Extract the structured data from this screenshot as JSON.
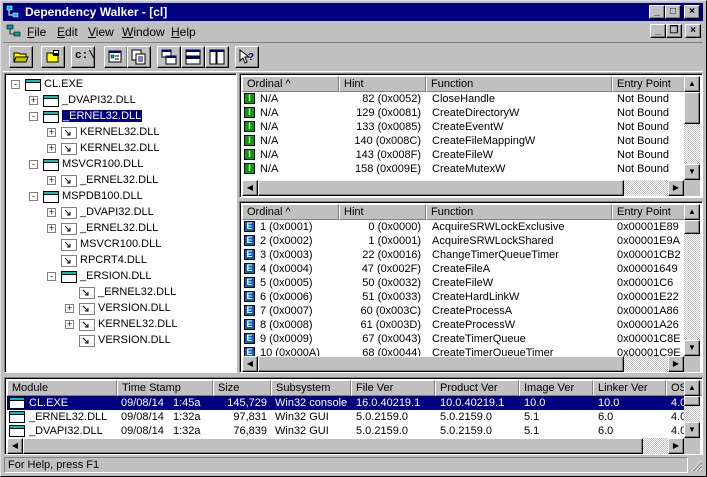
{
  "window": {
    "title": "Dependency Walker - [cl]",
    "caption_buttons": {
      "minimize": "_",
      "maximize": "□",
      "close": "×"
    },
    "mdi_buttons": {
      "minimize": "_",
      "restore": "❐",
      "close": "×"
    }
  },
  "menu": [
    {
      "label": "File",
      "key": "F",
      "rest": "ile"
    },
    {
      "label": "Edit",
      "key": "E",
      "rest": "dit"
    },
    {
      "label": "View",
      "key": "V",
      "rest": "iew"
    },
    {
      "label": "Window",
      "key": "W",
      "rest": "indow"
    },
    {
      "label": "Help",
      "key": "H",
      "rest": "elp"
    }
  ],
  "toolbar": {
    "buttons": [
      {
        "icon": "open-folder-icon"
      },
      {
        "icon": "save-icon"
      },
      {
        "icon": "cpath-icon",
        "text": "c:\\"
      },
      {
        "icon": "properties-icon"
      },
      {
        "icon": "copy-icon"
      },
      {
        "icon": "cascade-icon"
      },
      {
        "icon": "tile-horizontal-icon"
      },
      {
        "icon": "tile-vertical-icon"
      },
      {
        "icon": "help-context-icon"
      }
    ]
  },
  "tree": {
    "nodes": [
      {
        "label": "CL.EXE",
        "level": 0,
        "expander": "-",
        "icon": "exe"
      },
      {
        "label": "_DVAPI32.DLL",
        "level": 1,
        "expander": "+",
        "icon": "dll"
      },
      {
        "label": "_ERNEL32.DLL",
        "level": 1,
        "expander": "-",
        "icon": "dll",
        "selected": true
      },
      {
        "label": "KERNEL32.DLL",
        "level": 2,
        "expander": "+",
        "icon": "fwd"
      },
      {
        "label": "KERNEL32.DLL",
        "level": 2,
        "expander": "+",
        "icon": "fwd-link"
      },
      {
        "label": "MSVCR100.DLL",
        "level": 1,
        "expander": "-",
        "icon": "dll"
      },
      {
        "label": "_ERNEL32.DLL",
        "level": 2,
        "expander": "+",
        "icon": "fwd"
      },
      {
        "label": "MSPDB100.DLL",
        "level": 1,
        "expander": "-",
        "icon": "dll"
      },
      {
        "label": "_DVAPI32.DLL",
        "level": 2,
        "expander": "+",
        "icon": "fwd"
      },
      {
        "label": "_ERNEL32.DLL",
        "level": 2,
        "expander": "+",
        "icon": "fwd"
      },
      {
        "label": "MSVCR100.DLL",
        "level": 2,
        "expander": "",
        "icon": "fwd"
      },
      {
        "label": "RPCRT4.DLL",
        "level": 2,
        "expander": "",
        "icon": "fwd"
      },
      {
        "label": "_ERSION.DLL",
        "level": 2,
        "expander": "-",
        "icon": "dll"
      },
      {
        "label": "_ERNEL32.DLL",
        "level": 3,
        "expander": "",
        "icon": "fwd"
      },
      {
        "label": "VERSION.DLL",
        "level": 3,
        "expander": "+",
        "icon": "fwd"
      },
      {
        "label": "KERNEL32.DLL",
        "level": 3,
        "expander": "+",
        "icon": "fwd"
      },
      {
        "label": "VERSION.DLL",
        "level": 3,
        "expander": "",
        "icon": "fwd-link"
      }
    ]
  },
  "imports": {
    "headers": [
      "Ordinal ^",
      "Hint",
      "Function",
      "Entry Point"
    ],
    "rows": [
      {
        "type": "I",
        "ordinal": "N/A",
        "hint": "82  (0x0052)",
        "function": "CloseHandle",
        "entry": "Not Bound"
      },
      {
        "type": "I",
        "ordinal": "N/A",
        "hint": "129  (0x0081)",
        "function": "CreateDirectoryW",
        "entry": "Not Bound"
      },
      {
        "type": "I",
        "ordinal": "N/A",
        "hint": "133  (0x0085)",
        "function": "CreateEventW",
        "entry": "Not Bound"
      },
      {
        "type": "I",
        "ordinal": "N/A",
        "hint": "140  (0x008C)",
        "function": "CreateFileMappingW",
        "entry": "Not Bound"
      },
      {
        "type": "I",
        "ordinal": "N/A",
        "hint": "143  (0x008F)",
        "function": "CreateFileW",
        "entry": "Not Bound"
      },
      {
        "type": "I",
        "ordinal": "N/A",
        "hint": "158  (0x009E)",
        "function": "CreateMutexW",
        "entry": "Not Bound"
      }
    ]
  },
  "exports": {
    "headers": [
      "Ordinal ^",
      "Hint",
      "Function",
      "Entry Point"
    ],
    "rows": [
      {
        "type": "E",
        "ordinal": "1  (0x0001)",
        "hint": "0  (0x0000)",
        "function": "AcquireSRWLockExclusive",
        "entry": "0x00001E89"
      },
      {
        "type": "E",
        "ordinal": "2  (0x0002)",
        "hint": "1  (0x0001)",
        "function": "AcquireSRWLockShared",
        "entry": "0x00001E9A"
      },
      {
        "type": "E",
        "ordinal": "3  (0x0003)",
        "hint": "22  (0x0016)",
        "function": "ChangeTimerQueueTimer",
        "entry": "0x00001CB2"
      },
      {
        "type": "E",
        "ordinal": "4  (0x0004)",
        "hint": "47  (0x002F)",
        "function": "CreateFileA",
        "entry": "0x00001649"
      },
      {
        "type": "E",
        "ordinal": "5  (0x0005)",
        "hint": "50  (0x0032)",
        "function": "CreateFileW",
        "entry": "0x00001C6"
      },
      {
        "type": "E",
        "ordinal": "6  (0x0006)",
        "hint": "51  (0x0033)",
        "function": "CreateHardLinkW",
        "entry": "0x00001E22"
      },
      {
        "type": "E",
        "ordinal": "7  (0x0007)",
        "hint": "60  (0x003C)",
        "function": "CreateProcessA",
        "entry": "0x00001A86"
      },
      {
        "type": "E",
        "ordinal": "8  (0x0008)",
        "hint": "61  (0x003D)",
        "function": "CreateProcessW",
        "entry": "0x00001A26"
      },
      {
        "type": "E",
        "ordinal": "9  (0x0009)",
        "hint": "67  (0x0043)",
        "function": "CreateTimerQueue",
        "entry": "0x00001C8E"
      },
      {
        "type": "E",
        "ordinal": "10  (0x000A)",
        "hint": "68  (0x0044)",
        "function": "CreateTimerQueueTimer",
        "entry": "0x00001C9E"
      }
    ]
  },
  "modules": {
    "headers": [
      "Module",
      "Time Stamp",
      "Size",
      "Subsystem",
      "File Ver",
      "Product Ver",
      "Image Ver",
      "Linker Ver",
      "OS"
    ],
    "rows": [
      {
        "module": "CL.EXE",
        "date": "09/08/14",
        "time": "1:45a",
        "size": "145,729",
        "subsystem": "Win32 console",
        "filever": "16.0.40219.1",
        "productver": "10.0.40219.1",
        "imagever": "10.0",
        "linkerver": "10.0",
        "os": "4.0",
        "selected": true
      },
      {
        "module": "_ERNEL32.DLL",
        "date": "09/08/14",
        "time": "1:32a",
        "size": "97,831",
        "subsystem": "Win32 GUI",
        "filever": "5.0.2159.0",
        "productver": "5.0.2159.0",
        "imagever": "5.1",
        "linkerver": "6.0",
        "os": "4.0"
      },
      {
        "module": "_DVAPI32.DLL",
        "date": "09/08/14",
        "time": "1:32a",
        "size": "76,839",
        "subsystem": "Win32 GUI",
        "filever": "5.0.2159.0",
        "productver": "5.0.2159.0",
        "imagever": "5.1",
        "linkerver": "6.0",
        "os": "4.0"
      }
    ]
  },
  "statusbar": {
    "text": "For Help, press F1"
  },
  "colors": {
    "titlebar": "#000080",
    "selection": "#000080",
    "face": "#c0c0c0"
  }
}
